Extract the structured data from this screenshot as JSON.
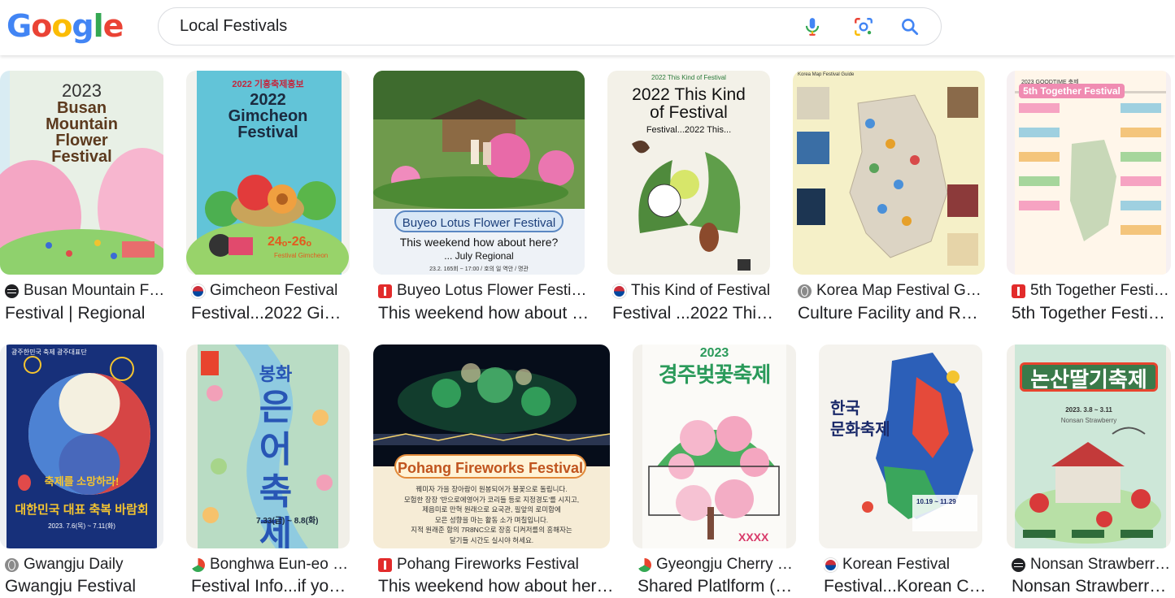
{
  "header": {
    "logo": [
      "G",
      "o",
      "o",
      "g",
      "l",
      "e"
    ],
    "logo_colors": [
      "#4285F4",
      "#EA4335",
      "#FBBC05",
      "#4285F4",
      "#34A853",
      "#EA4335"
    ],
    "query": "Local Festivals"
  },
  "results": [
    {
      "source": "Busan Mountain Flow…",
      "title": "Festival | Regional",
      "favicon": "globe-dark-icon",
      "thumb": {
        "line1": "2023",
        "line2": "Busan",
        "line3": "Mountain",
        "line4": "Flower",
        "line5": "Festival"
      }
    },
    {
      "source": "Gimcheon Festival",
      "title": "Festival...2022 Gimch…",
      "favicon": "korea-flag-icon",
      "thumb": {
        "line1": "2022 기흥축제흥보",
        "line2": "2022",
        "line3": "Gimcheon",
        "line4": "Festival",
        "line5": "24ₒ-26ₒ",
        "line6": "Festival Gimcheon"
      }
    },
    {
      "source": "Buyeo Lotus Flower Festival",
      "title": "This weekend how about here?",
      "favicon": "red-square-icon",
      "thumb": {
        "banner": "Buyeo Lotus Flower Festival",
        "line1": "This weekend how about here?",
        "line2": "... July Regional",
        "line3": "23.2. 165회 ~ 17:00 / 호의 일 역안 / 명관"
      }
    },
    {
      "source": "This Kind of Festival",
      "title": "Festival ...2022 This…",
      "favicon": "korea-flag-icon",
      "thumb": {
        "line1": "2022 This Kind of Festival",
        "line2": "2022 This Kind",
        "line3": "of Festival",
        "line4": "Festival...2022 This..."
      }
    },
    {
      "source": "Korea Map Festival Guide",
      "title": "Culture Facility and Regio…",
      "favicon": "globe-gray-icon",
      "thumb": {
        "line1": "Korea Map Festival Guide"
      }
    },
    {
      "source": "5th Together Festival",
      "title": "5th Together Festival…",
      "favicon": "red-square-icon",
      "thumb": {
        "line1": "2023 GOODTIME 축제",
        "line2": "5th Together Festival"
      }
    },
    {
      "source": "Gwangju Daily",
      "title": "Gwangju Festival",
      "favicon": "globe-gray-icon",
      "thumb": {
        "line1": "광주한민국 축제 광주대표단",
        "line2": "축제를 소망하라!",
        "line3": "대한민국 대표 축복 바람회",
        "line4": "2023. 7.6(목) ~ 7.11(화)"
      }
    },
    {
      "source": "Bonghwa Eun-eo Fe…",
      "title": "Festival Info...if you g…",
      "favicon": "swirl-icon",
      "thumb": {
        "line1": "봉화",
        "line2": "은어",
        "line3": "축제",
        "line4": "7.33(금) ~ 8.8(화)"
      }
    },
    {
      "source": "Pohang Fireworks Festival",
      "title": "This weekend how about here? …",
      "favicon": "red-square-icon",
      "thumb": {
        "banner": "Pohang Fireworks Festival",
        "line1": "꿰미자 가을 장아람이 원봉되어가 불꽃으로 돌립니다.",
        "line2": "모험한 장장 '반으로에영어가 코리들 등로 지정경도'를 시지고,",
        "line3": "제읍미로 만혁 원래으로 요국관, 필앞의 로미합에",
        "line4": "모은 성향을 마는 활동 소가 며칠입니다.",
        "line5": "지적 원래준 함의 7R8NC으로 장흥 디켜저를의 흥해자는",
        "line6": "달기들 시간도 실시야 허세요."
      }
    },
    {
      "source": "Gyeongju Cherry Blo…",
      "title": "Shared Platlform (Se…",
      "favicon": "swirl-icon",
      "thumb": {
        "line1": "2023",
        "line2": "경주벚꽃축제"
      }
    },
    {
      "source": "Korean Festival",
      "title": "Festival...Korean Cult…",
      "favicon": "korea-flag-icon",
      "thumb": {
        "line1": "한국",
        "line2": "문화축제",
        "line3": "10.19 ~ 11.29"
      }
    },
    {
      "source": "Nonsan Strawberry …",
      "title": "Nonsan Strawberry…",
      "favicon": "globe-dark-icon",
      "thumb": {
        "line1": "논산딸기축제",
        "line2": "2023. 3.8 ~ 3.11",
        "line3": "Nonsan Strawberry"
      }
    }
  ]
}
